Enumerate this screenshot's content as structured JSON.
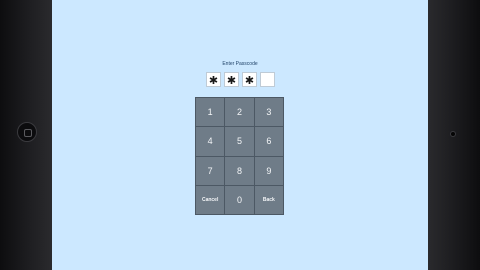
{
  "passcode": {
    "prompt": "Enter Passcode",
    "digits": [
      "✱",
      "✱",
      "✱",
      ""
    ]
  },
  "keypad": {
    "keys": [
      "1",
      "2",
      "3",
      "4",
      "5",
      "6",
      "7",
      "8",
      "9",
      "Cancel",
      "0",
      "Back"
    ]
  },
  "colors": {
    "screen_background": "#cce8ff",
    "key_background": "#6f7c88",
    "key_text": "#f4f6f8"
  }
}
